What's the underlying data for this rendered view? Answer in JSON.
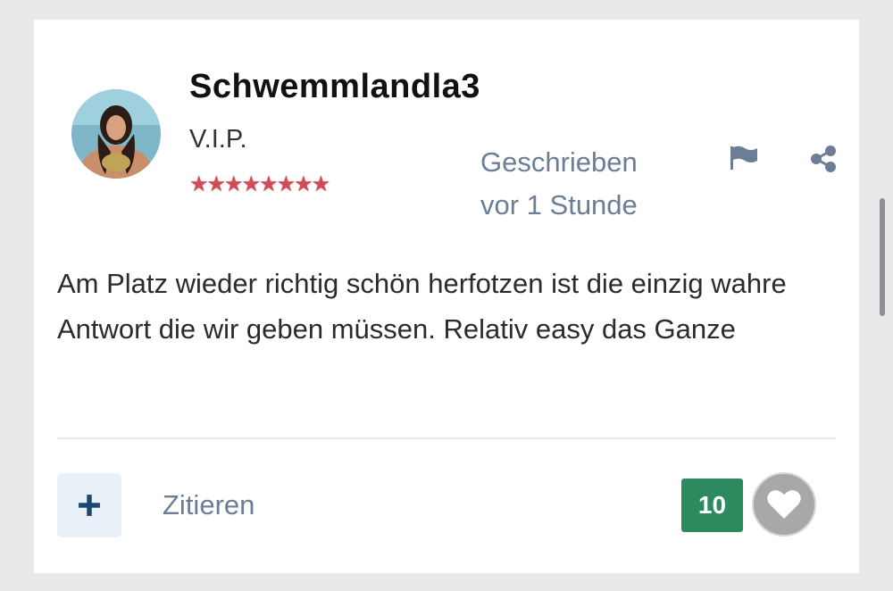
{
  "post": {
    "username": "Schwemmlandla3",
    "rank": "V.I.P.",
    "stars": "★★★★★★★★",
    "meta_line1": "Geschrieben",
    "meta_line2": "vor 1 Stunde",
    "body": "Am Platz wieder richtig schön herfotzen ist die einzig wahre Antwort die wir geben müssen. Relativ easy das Ganze",
    "quote_label": "Zitieren",
    "plus_label": "+",
    "like_count": "10"
  },
  "icons": {
    "flag": "flag-icon",
    "share": "share-icon",
    "heart": "heart-icon",
    "plus": "plus-icon"
  },
  "colors": {
    "meta_text": "#6c7e95",
    "like_badge": "#2d8a5e",
    "stars": "#d14c58",
    "plus_bg": "#e8f0f8"
  }
}
